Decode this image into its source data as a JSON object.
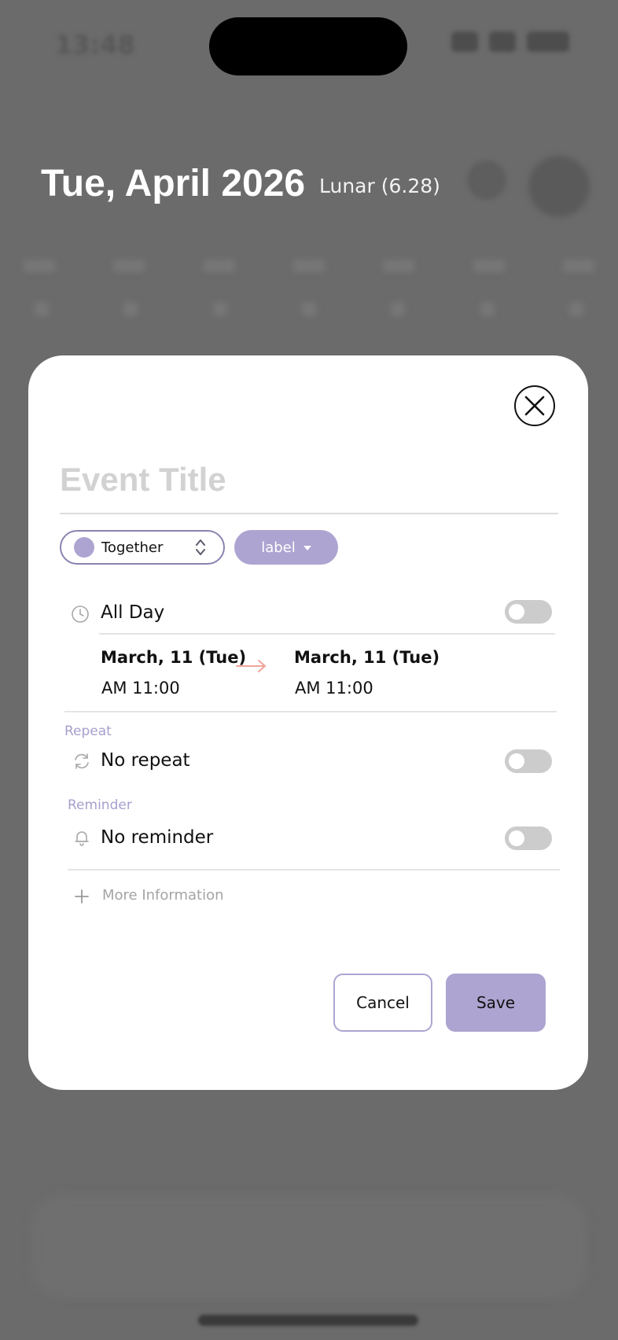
{
  "status_bar": {
    "time": "13:48"
  },
  "header": {
    "title": "Tue, April 2026",
    "lunar": "Lunar (6.28)"
  },
  "modal": {
    "title_placeholder": "Event Title",
    "calendar": {
      "name": "Together",
      "color": "#aea4d1"
    },
    "label_button": "label",
    "all_day": {
      "label": "All Day",
      "enabled": false
    },
    "start": {
      "date": "March, 11 (Tue)",
      "time": "AM 11:00"
    },
    "end": {
      "date": "March, 11 (Tue)",
      "time": "AM 11:00"
    },
    "repeat": {
      "section": "Repeat",
      "value": "No repeat",
      "enabled": false
    },
    "reminder": {
      "section": "Reminder",
      "value": "No reminder",
      "enabled": false
    },
    "more_information": "More Information",
    "cancel": "Cancel",
    "save": "Save"
  },
  "colors": {
    "accent": "#aea4d1",
    "accent_border": "#8c82b0",
    "arrow": "#f0a59a",
    "placeholder": "#d2d2d2"
  },
  "icons": {
    "close": "close-icon",
    "clock": "clock-icon",
    "repeat": "repeat-icon",
    "bell": "bell-icon",
    "plus": "plus-icon",
    "arrow": "arrow-right-icon"
  }
}
